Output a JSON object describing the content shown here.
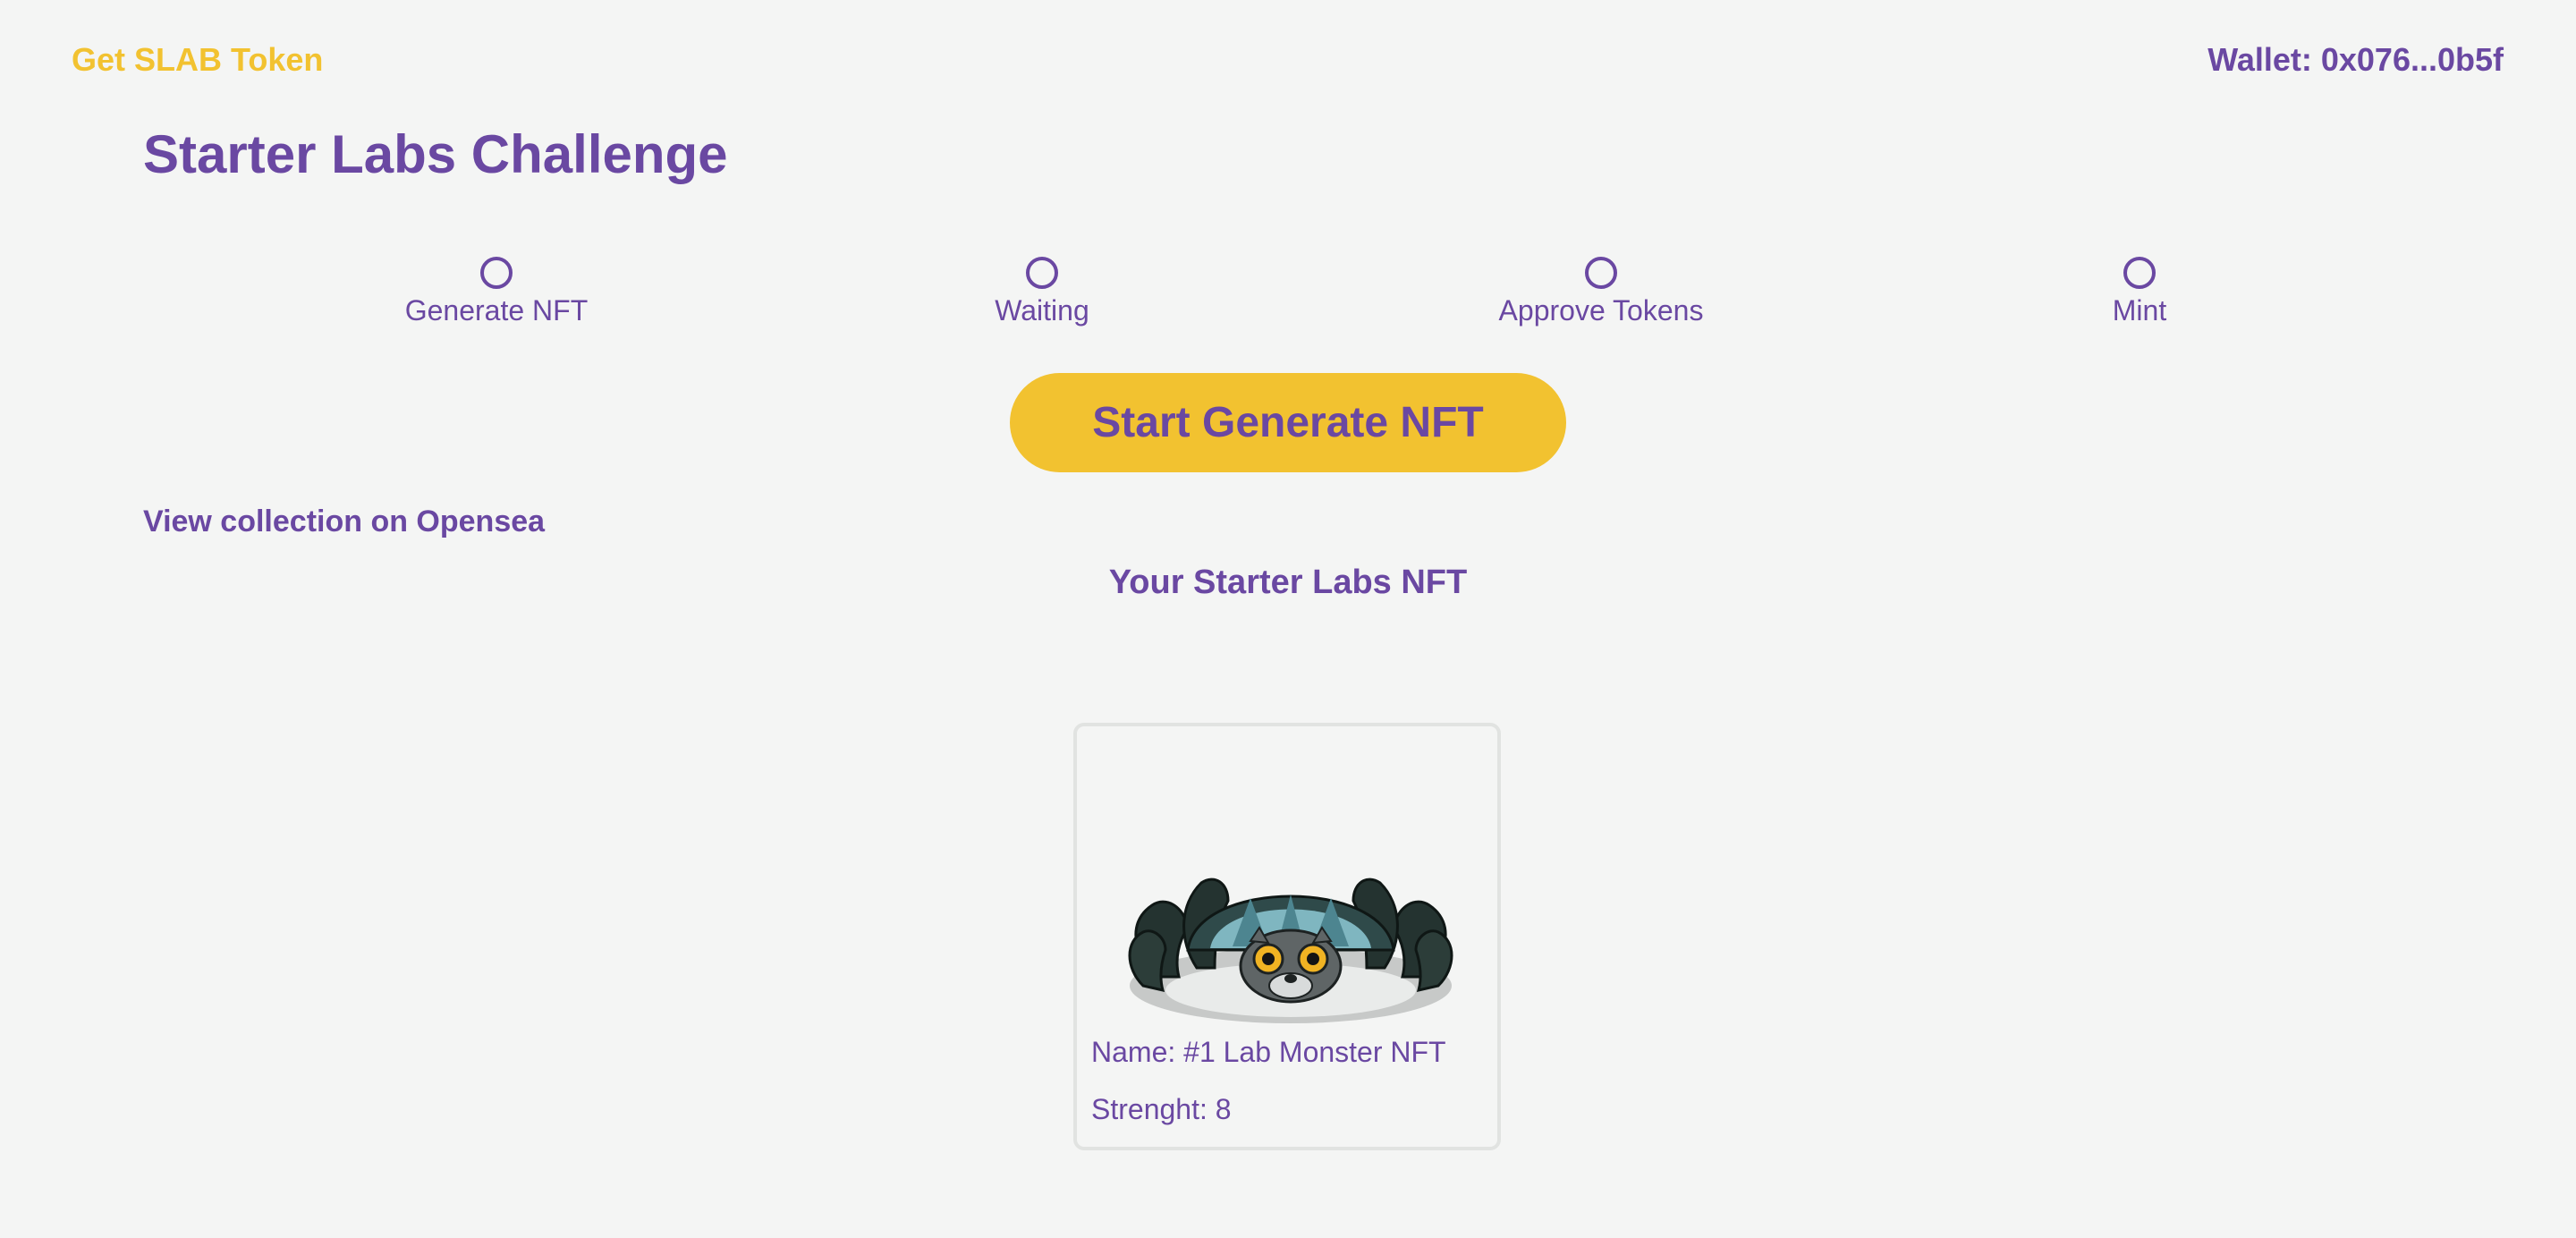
{
  "header": {
    "token_link": "Get SLAB Token",
    "wallet_label": "Wallet: 0x076...0b5f"
  },
  "page": {
    "title": "Starter Labs Challenge"
  },
  "steps": [
    {
      "label": "Generate NFT"
    },
    {
      "label": "Waiting"
    },
    {
      "label": "Approve Tokens"
    },
    {
      "label": "Mint"
    }
  ],
  "actions": {
    "primary_button": "Start Generate NFT",
    "opensea_link": "View collection on Opensea"
  },
  "nft_section": {
    "title": "Your Starter Labs NFT",
    "card": {
      "name_line": "Name: #1 Lab Monster NFT",
      "strength_line": "Strenght: 8",
      "image_icon": "lab-monster-spider-icon"
    }
  },
  "colors": {
    "accent_purple": "#6a48a2",
    "accent_yellow": "#f2c230",
    "background": "#f4f5f4"
  }
}
